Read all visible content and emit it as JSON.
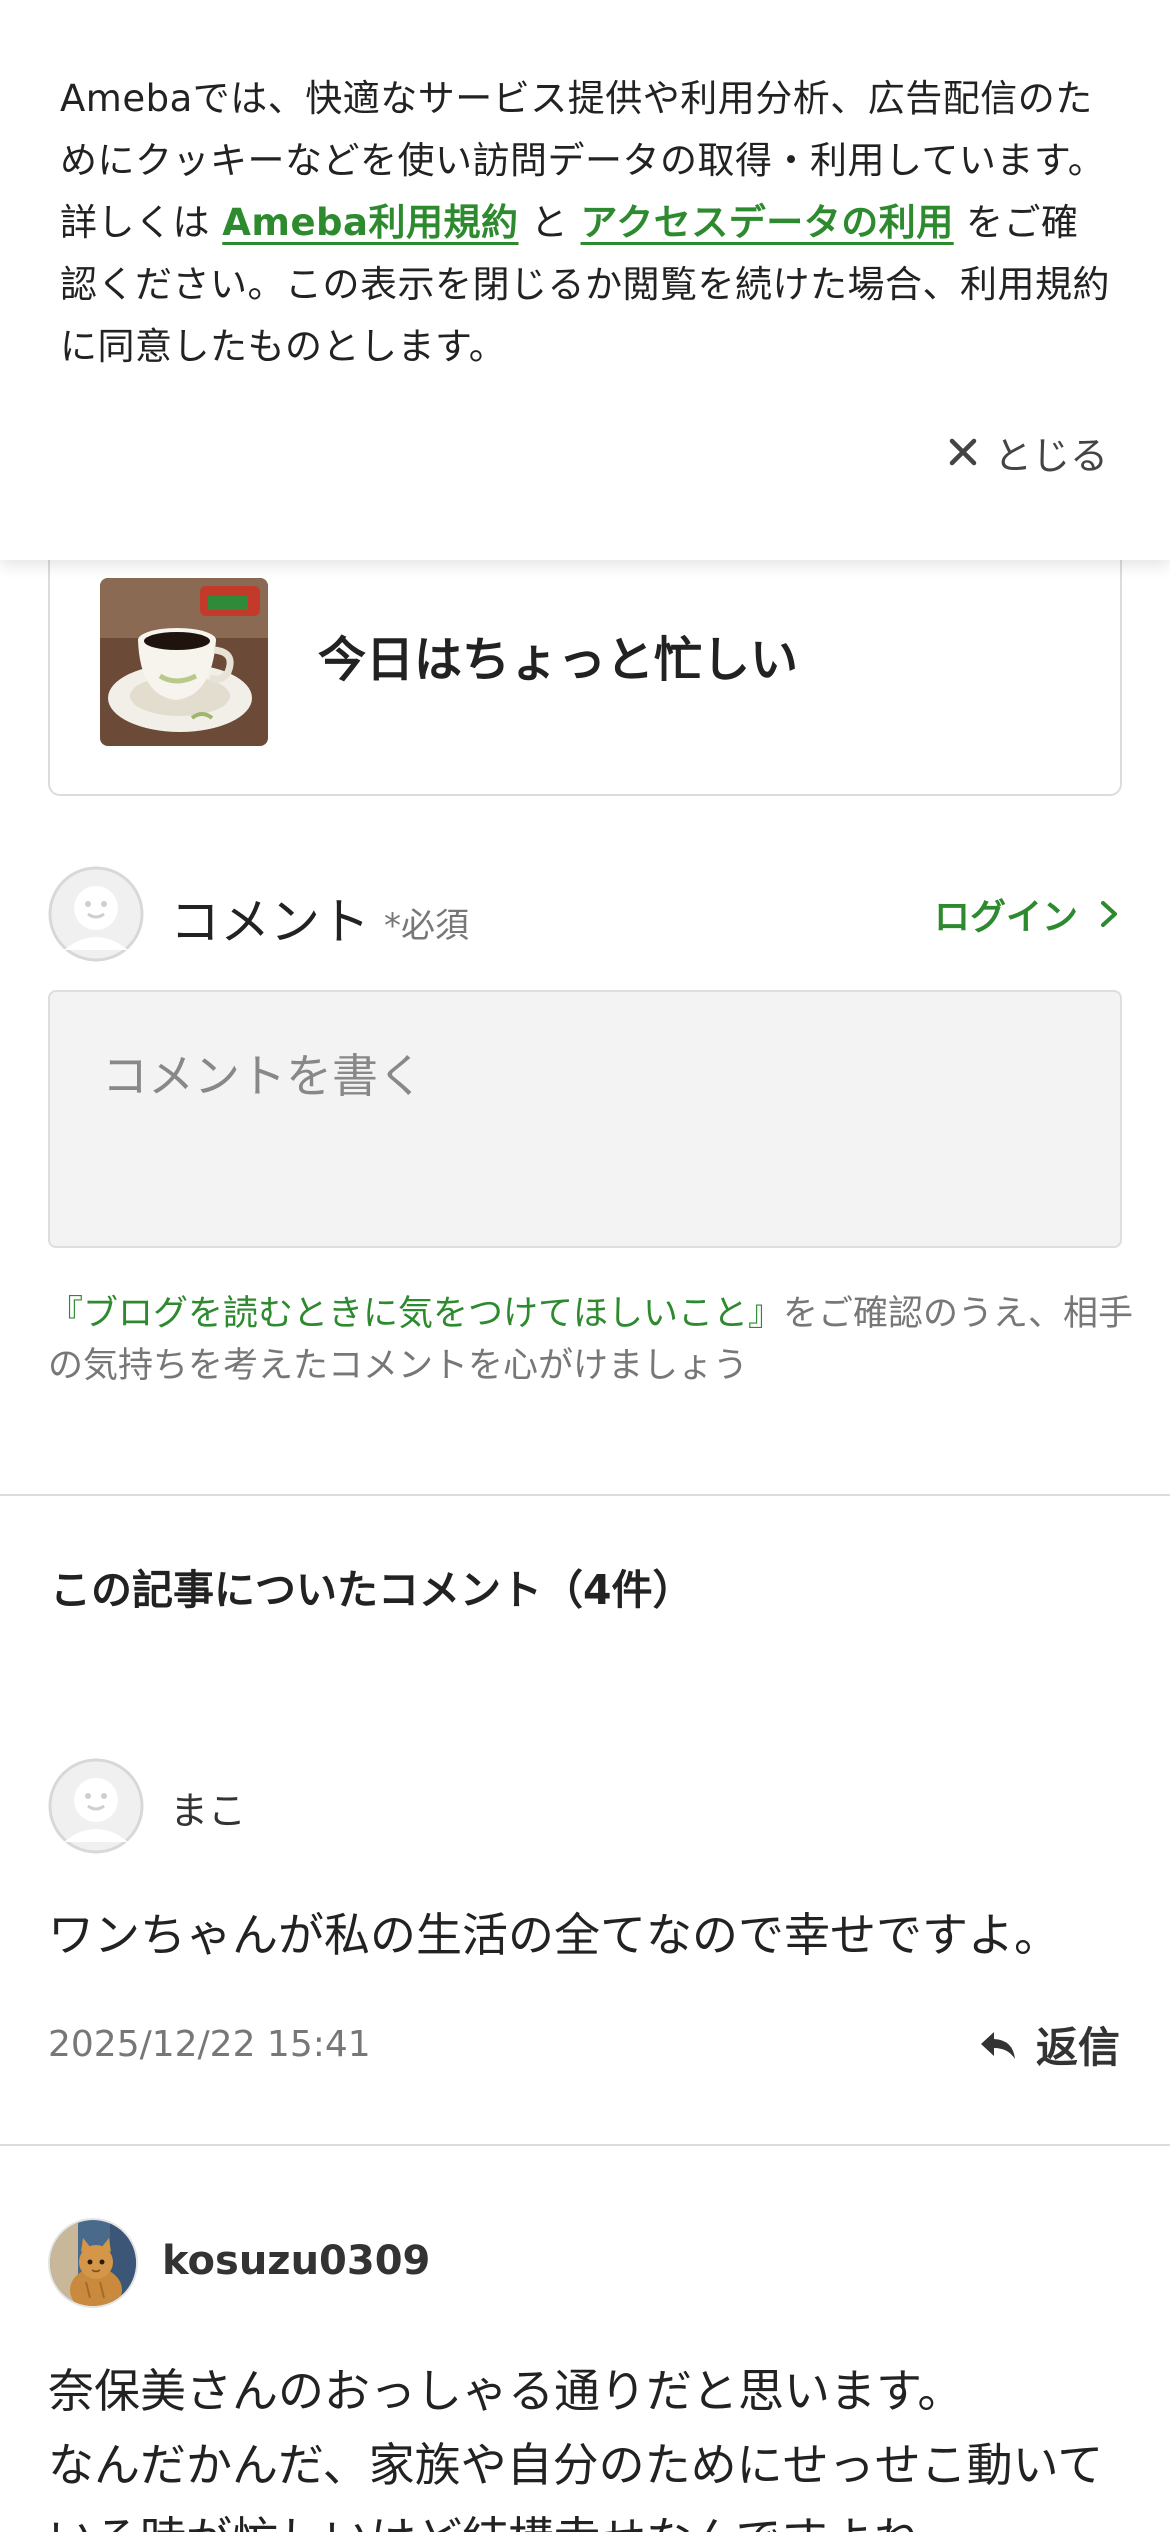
{
  "cookie_banner": {
    "text_before": "Amebaでは、快適なサービス提供や利用分析、広告配信のためにクッキーなどを使い訪問データの取得・利用しています。詳しくは ",
    "link1": "Ameba利用規約",
    "text_between": " と ",
    "link2": "アクセスデータの利用",
    "text_after": " をご確認ください。この表示を閉じるか閲覧を続けた場合、利用規約に同意したものとします。",
    "close_label": "とじる"
  },
  "article": {
    "title": "今日はちょっと忙しい"
  },
  "comment_form": {
    "label": "コメント",
    "required": "*必須",
    "login": "ログイン",
    "placeholder": "コメントを書く",
    "guideline_link": "『ブログを読むときに気をつけてほしいこと』",
    "guideline_text": "をご確認のうえ、相手の気持ちを考えたコメントを心がけましょう"
  },
  "comments": {
    "heading": "この記事についたコメント（4件）",
    "items": [
      {
        "name": "まこ",
        "body": "ワンちゃんが私の生活の全てなので幸せですよ。",
        "date": "2025/12/22 15:41",
        "reply": "返信"
      },
      {
        "name": "kosuzu0309",
        "body": "奈保美さんのおっしゃる通りだと思います。\nなんだかんだ、家族や自分のためにせっせこ動いている時が忙しいけど結構幸せなんですよね"
      }
    ]
  },
  "colors": {
    "accent_green": "#2d8a2f",
    "text_dark": "#222222",
    "text_muted": "#777777",
    "divider": "#dcdcdc"
  }
}
